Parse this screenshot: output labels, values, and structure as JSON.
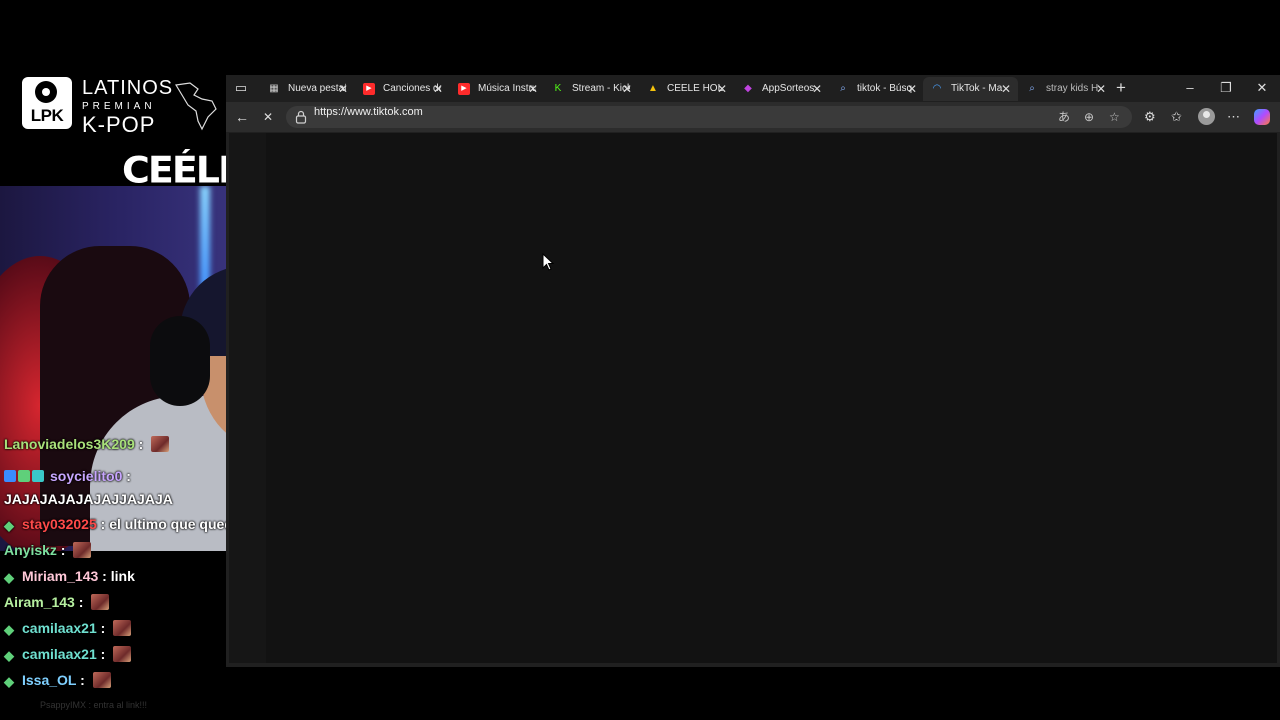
{
  "overlay": {
    "logo_badge": "LPK",
    "logo_line1": "LATINOS",
    "logo_line2": "PREMIAN",
    "logo_line3": "K-POP",
    "streamer_name": "CEÉLE"
  },
  "chat": [
    {
      "user": "Lanoviadelos3K209",
      "user_color": "#a8e07a",
      "message": "",
      "emote": true,
      "gem": false,
      "badges": false
    },
    {
      "user": "soycielito0",
      "user_color": "#c8a6ff",
      "message": "JAJAJAJAJAJAJJAJAJA",
      "emote": false,
      "gem": false,
      "badges": true
    },
    {
      "user": "stay032025",
      "user_color": "#ff4a4a",
      "message": "el ultimo que queda",
      "emote": false,
      "gem": true,
      "badges": false
    },
    {
      "user": "Anyiskz",
      "user_color": "#7ee0a0",
      "message": "",
      "emote": true,
      "gem": false,
      "badges": false
    },
    {
      "user": "Miriam_143",
      "user_color": "#ffc8d8",
      "message": "link",
      "emote": false,
      "gem": true,
      "badges": false
    },
    {
      "user": "Airam_143",
      "user_color": "#b6f0a0",
      "message": "",
      "emote": true,
      "gem": false,
      "badges": false
    },
    {
      "user": "camilaax21",
      "user_color": "#6fe0d0",
      "message": "",
      "emote": true,
      "gem": true,
      "badges": false
    },
    {
      "user": "camilaax21",
      "user_color": "#6fe0d0",
      "message": "",
      "emote": true,
      "gem": true,
      "badges": false
    },
    {
      "user": "Issa_OL",
      "user_color": "#7fd0ff",
      "message": "",
      "emote": true,
      "gem": true,
      "badges": false
    }
  ],
  "chat_ghost": "PsappyIMX : entra al link!!!",
  "browser": {
    "tabs": [
      {
        "title": "Nueva pestaña",
        "icon": "new-tab-page-icon",
        "icon_color": "#cfcfcf"
      },
      {
        "title": "Canciones de",
        "icon": "youtube-icon",
        "icon_color": "#ff2b2b"
      },
      {
        "title": "Música Instru",
        "icon": "youtube-icon",
        "icon_color": "#ff2b2b"
      },
      {
        "title": "Stream - Kick",
        "icon": "kick-icon",
        "icon_color": "#53fc18"
      },
      {
        "title": "CEELE HOL",
        "icon": "google-drive-icon",
        "icon_color": "#f4c20d"
      },
      {
        "title": "AppSorteos",
        "icon": "appsorteos-icon",
        "icon_color": "#c043e0"
      },
      {
        "title": "tiktok - Búsq",
        "icon": "search-icon",
        "icon_color": "#8ab4ff"
      },
      {
        "title": "TikTok - Ma",
        "icon": "loading-spinner-icon",
        "icon_color": "#4aa3ff"
      },
      {
        "title": "stray kids H",
        "icon": "search-icon",
        "icon_color": "#8ab4ff"
      }
    ],
    "active_tab": 7,
    "url": "https://www.tiktok.com",
    "new_tab_symbol": "+",
    "minimize_symbol": "–",
    "restore_symbol": "❐",
    "close_symbol": "✕",
    "back_symbol": "←",
    "stop_symbol": "✕",
    "tab_close_symbol": "✕"
  }
}
